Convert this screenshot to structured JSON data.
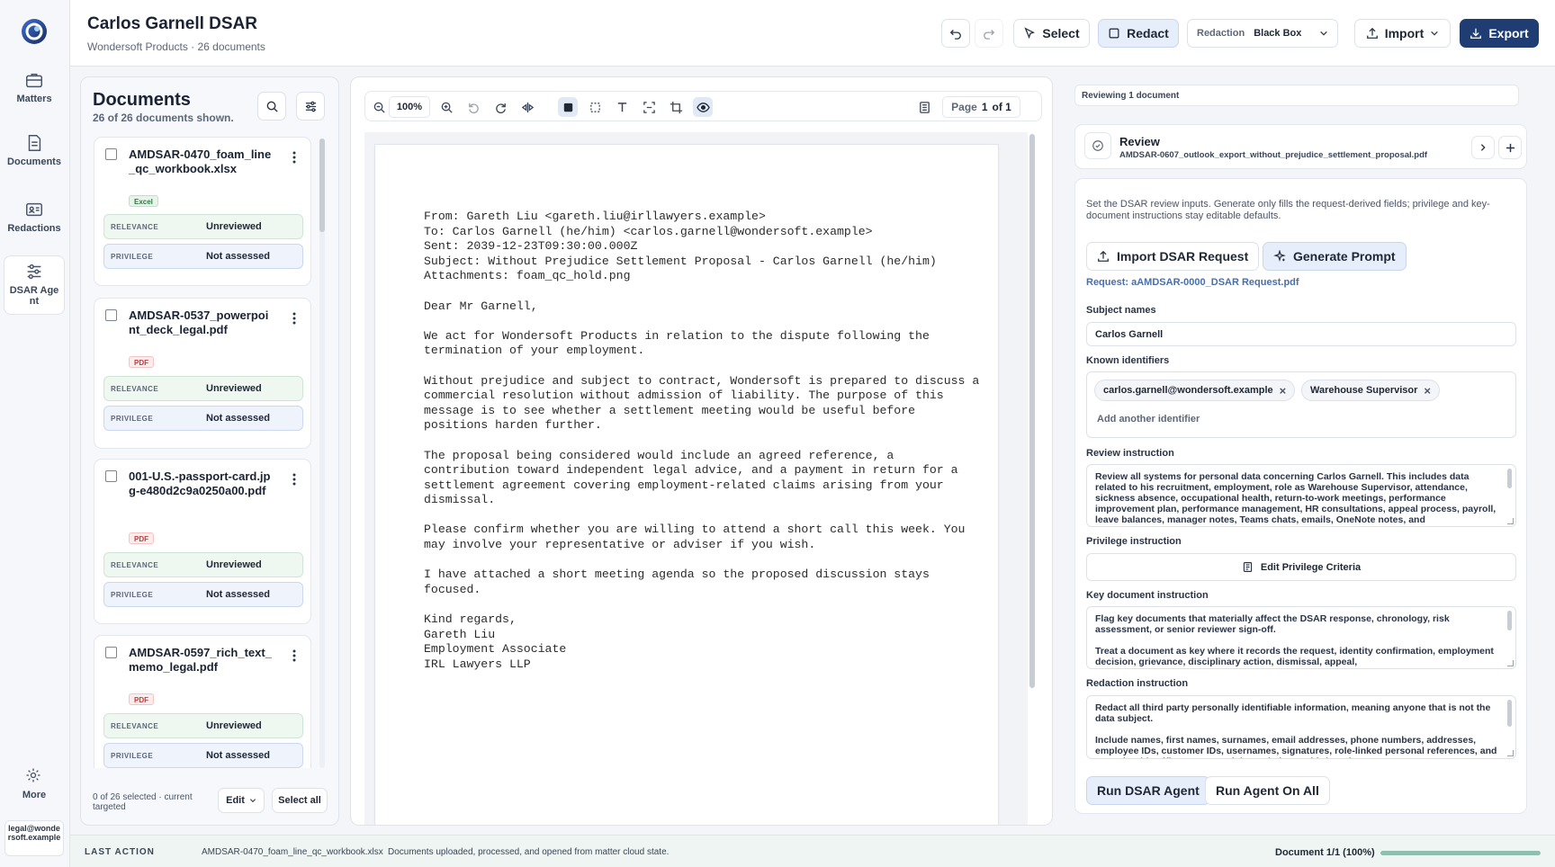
{
  "rail": {
    "items": [
      {
        "label": "Matters",
        "icon": "briefcase-icon"
      },
      {
        "label": "Documents",
        "icon": "document-icon"
      },
      {
        "label": "Redactions",
        "icon": "id-card-icon"
      },
      {
        "label": "DSAR Agent",
        "icon": "sliders-icon"
      }
    ],
    "more_label": "More",
    "user": "legal@wondersoft.example"
  },
  "header": {
    "title": "Carlos Garnell DSAR",
    "subtitle": "Wondersoft Products · 26 documents",
    "select_label": "Select",
    "redact_label": "Redact",
    "redaction_label": "Redaction",
    "redaction_value": "Black Box",
    "import_label": "Import",
    "export_label": "Export"
  },
  "documents": {
    "title": "Documents",
    "count_text": "26 of 26 documents shown.",
    "relevance_label": "RELEVANCE",
    "privilege_label": "PRIVILEGE",
    "items": [
      {
        "name": "AMDSAR-0470_foam_line_qc_workbook.xlsx",
        "type": "Excel",
        "relevance": "Unreviewed",
        "privilege": "Not assessed"
      },
      {
        "name": "AMDSAR-0537_powerpoint_deck_legal.pdf",
        "type": "PDF",
        "relevance": "Unreviewed",
        "privilege": "Not assessed"
      },
      {
        "name": "001-U.S.-passport-card.jpg-e480d2c9a0250a00.pdf",
        "type": "PDF",
        "relevance": "Unreviewed",
        "privilege": "Not assessed"
      },
      {
        "name": "AMDSAR-0597_rich_text_memo_legal.pdf",
        "type": "PDF",
        "relevance": "Unreviewed",
        "privilege": "Not assessed"
      }
    ],
    "footer_text": "0 of 26 selected · current targeted",
    "edit_label": "Edit",
    "select_all_label": "Select all"
  },
  "viewer": {
    "zoom": "100%",
    "page_label": "Page",
    "page_current": "1",
    "page_of": "of 1",
    "content": "From: Gareth Liu <gareth.liu@irllawyers.example>\nTo: Carlos Garnell (he/him) <carlos.garnell@wondersoft.example>\nSent: 2039-12-23T09:30:00.000Z\nSubject: Without Prejudice Settlement Proposal - Carlos Garnell (he/him)\nAttachments: foam_qc_hold.png\n\nDear Mr Garnell,\n\nWe act for Wondersoft Products in relation to the dispute following the\ntermination of your employment.\n\nWithout prejudice and subject to contract, Wondersoft is prepared to discuss a\ncommercial resolution without admission of liability. The purpose of this\nmessage is to see whether a settlement meeting would be useful before\npositions harden further.\n\nThe proposal being considered would include an agreed reference, a\ncontribution toward independent legal advice, and a payment in return for a\nsettlement agreement covering employment-related claims arising from your\ndismissal.\n\nPlease confirm whether you are willing to attend a short call this week. You\nmay involve your representative or adviser if you wish.\n\nI have attached a short meeting agenda so the proposed discussion stays\nfocused.\n\nKind regards,\nGareth Liu\nEmployment Associate\nIRL Lawyers LLP"
  },
  "review": {
    "reviewing_text": "Reviewing 1 document",
    "title": "Review",
    "document": "AMDSAR-0607_outlook_export_without_prejudice_settlement_proposal.pdf",
    "description": "Set the DSAR review inputs. Generate only fills the request-derived fields; privilege and key-document instructions stay editable defaults.",
    "import_request_label": "Import DSAR Request",
    "generate_prompt_label": "Generate Prompt",
    "request_text": "Request: aAMDSAR-0000_DSAR Request.pdf",
    "subject_names_label": "Subject names",
    "subject_names_value": "Carlos Garnell",
    "known_identifiers_label": "Known identifiers",
    "identifiers": [
      "carlos.garnell@wondersoft.example",
      "Warehouse Supervisor"
    ],
    "add_identifier_placeholder": "Add another identifier",
    "review_instruction_label": "Review instruction",
    "review_instruction": "Review all systems for personal data concerning Carlos Garnell. This includes data related to his recruitment, employment, role as Warehouse Supervisor, attendance, sickness absence, occupational health, return-to-work meetings, performance improvement plan, performance management, HR consultations, appeal process, payroll, leave balances, manager notes, Teams chats, emails, OneNote notes, and",
    "privilege_instruction_label": "Privilege instruction",
    "edit_privilege_label": "Edit Privilege Criteria",
    "key_document_label": "Key document instruction",
    "key_document_p1": "Flag key documents that materially affect the DSAR response, chronology, risk assessment, or senior reviewer sign-off.",
    "key_document_p2": "Treat a document as key where it records the request, identity confirmation, employment decision, grievance, disciplinary action, dismissal, appeal,",
    "redaction_instruction_label": "Redaction instruction",
    "redaction_p1": "Redact all third party personally identifiable information, meaning anyone that is not the data subject.",
    "redaction_p2": "Include names, first names, surnames, email addresses, phone numbers, addresses, employee IDs, customer IDs, usernames, signatures, role-linked personal references, and any other identifier or personal data relating to third parties.",
    "run_agent_label": "Run DSAR Agent",
    "run_all_label": "Run Agent On All"
  },
  "footer": {
    "label": "LAST ACTION",
    "file": "AMDSAR-0470_foam_line_qc_workbook.xlsx",
    "message": "Documents uploaded, processed, and opened from matter cloud state.",
    "progress_text": "Document 1/1 (100%)",
    "progress_fraction": 1.0
  }
}
